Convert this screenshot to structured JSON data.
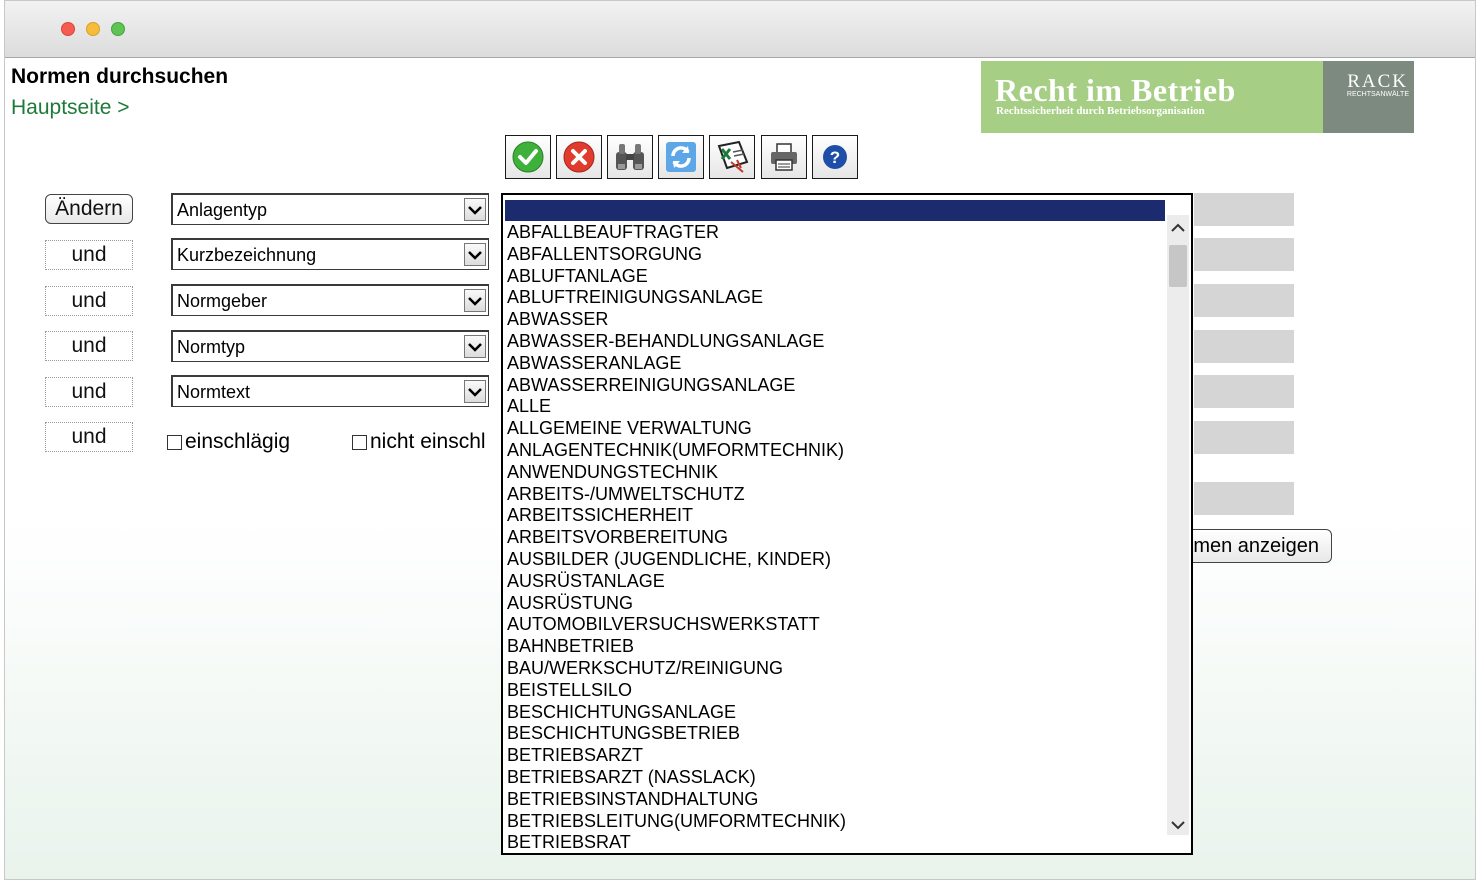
{
  "page": {
    "title": "Normen durchsuchen",
    "breadcrumb": "Hauptseite >"
  },
  "logo": {
    "brand": "Recht im Betrieb",
    "tagline": "Rechtssicherheit durch Betriebsorganisation",
    "rack": "RACK",
    "rack_sub": "RECHTSANWÄLTE",
    "color": "#a6cf85"
  },
  "toolbar": {
    "icons": [
      "check-icon",
      "cancel-icon",
      "binoculars-icon",
      "refresh-icon",
      "excel-export-icon",
      "print-icon",
      "help-icon"
    ]
  },
  "conditions": [
    {
      "button": "Ändern",
      "field": "Anlagentyp"
    },
    {
      "button": "und",
      "field": "Kurzbezeichnung"
    },
    {
      "button": "und",
      "field": "Normgeber"
    },
    {
      "button": "und",
      "field": "Normtyp"
    },
    {
      "button": "und",
      "field": "Normtext"
    }
  ],
  "extra_condition": {
    "button": "und",
    "checkbox1": "einschlägig",
    "checkbox2": "nicht einschl"
  },
  "show_button": "men anzeigen",
  "dropdown": {
    "selected": "",
    "options": [
      "ABFALLBEAUFTRAGTER",
      "ABFALLENTSORGUNG",
      "ABLUFTANLAGE",
      "ABLUFTREINIGUNGSANLAGE",
      "ABWASSER",
      "ABWASSER-BEHANDLUNGSANLAGE",
      "ABWASSERANLAGE",
      "ABWASSERREINIGUNGSANLAGE",
      "ALLE",
      "ALLGEMEINE VERWALTUNG",
      "ANLAGENTECHNIK(UMFORMTECHNIK)",
      "ANWENDUNGSTECHNIK",
      "ARBEITS-/UMWELTSCHUTZ",
      "ARBEITSSICHERHEIT",
      "ARBEITSVORBEREITUNG",
      "AUSBILDER (JUGENDLICHE, KINDER)",
      "AUSRÜSTANLAGE",
      "AUSRÜSTUNG",
      "AUTOMOBILVERSUCHSWERKSTATT",
      "BAHNBETRIEB",
      "BAU/WERKSCHUTZ/REINIGUNG",
      "BEISTELLSILO",
      "BESCHICHTUNGSANLAGE",
      "BESCHICHTUNGSBETRIEB",
      "BETRIEBSARZT",
      "BETRIEBSARZT (NASSLACK)",
      "BETRIEBSINSTANDHALTUNG",
      "BETRIEBSLEITUNG(UMFORMTECHNIK)",
      "BETRIEBSRAT"
    ]
  }
}
